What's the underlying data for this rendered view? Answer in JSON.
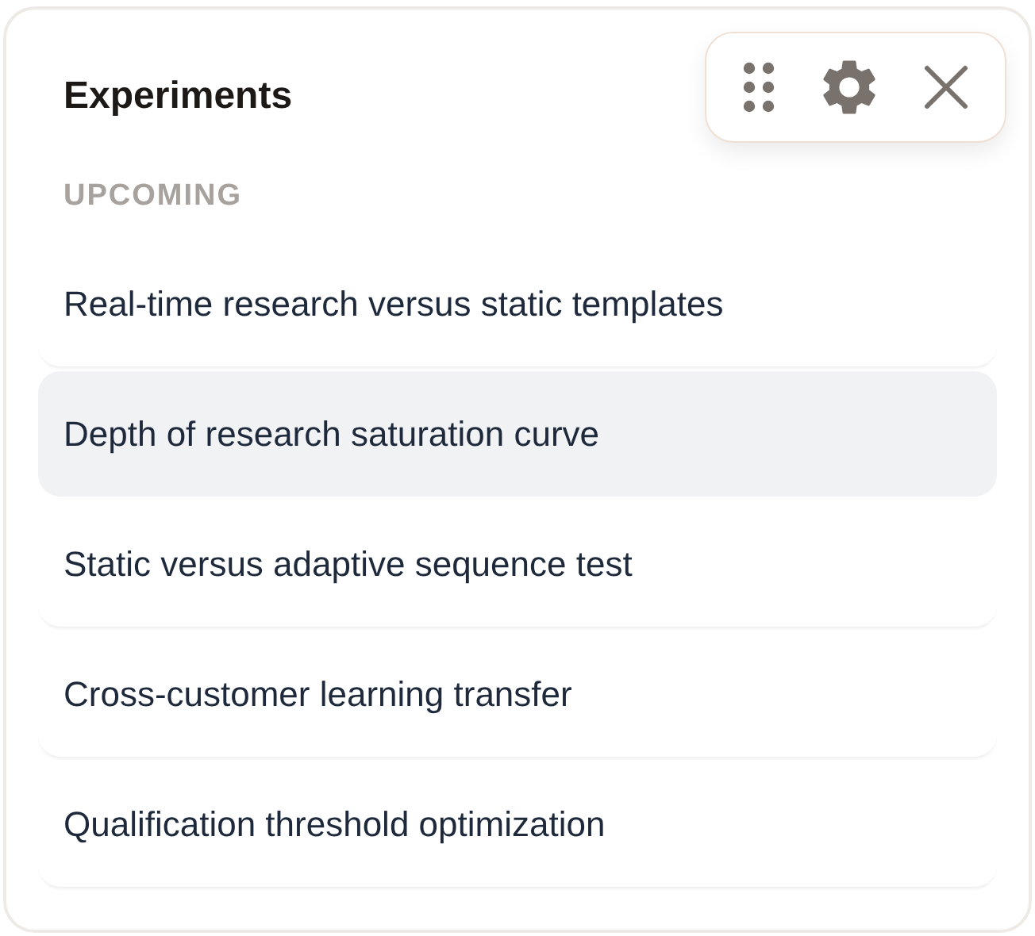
{
  "title": "Experiments",
  "section": "UPCOMING",
  "items": [
    {
      "label": "Real-time research versus static templates",
      "selected": false
    },
    {
      "label": "Depth of research saturation curve",
      "selected": true
    },
    {
      "label": "Static versus adaptive sequence test",
      "selected": false
    },
    {
      "label": "Cross-customer learning transfer",
      "selected": false
    },
    {
      "label": "Qualification threshold optimization",
      "selected": false
    }
  ]
}
